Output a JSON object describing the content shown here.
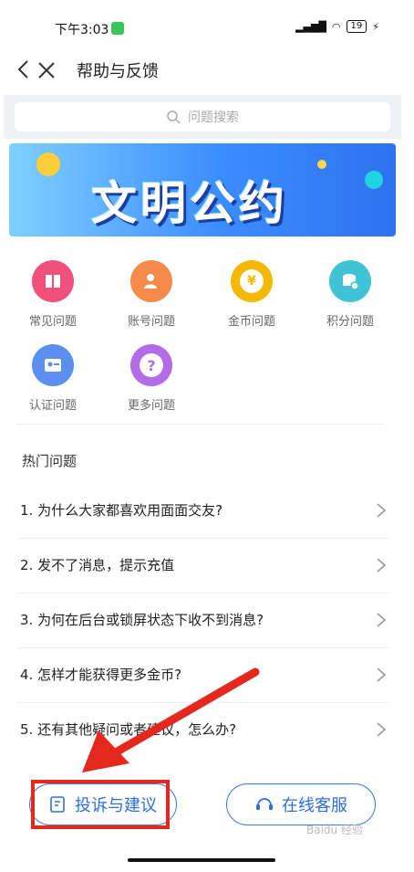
{
  "status": {
    "time": "下午3:03",
    "battery": "19"
  },
  "nav": {
    "title": "帮助与反馈"
  },
  "search": {
    "placeholder": "问题搜索"
  },
  "banner": {
    "title": "文明公约"
  },
  "categories": [
    {
      "label": "常见问题",
      "icon": "book-icon",
      "color": "#f0507a"
    },
    {
      "label": "账号问题",
      "icon": "account-icon",
      "color": "#f58a4a"
    },
    {
      "label": "金币问题",
      "icon": "coin-icon",
      "color": "#f5b800"
    },
    {
      "label": "积分问题",
      "icon": "points-icon",
      "color": "#3ec4d4"
    },
    {
      "label": "认证问题",
      "icon": "id-card-icon",
      "color": "#5b8ff0"
    },
    {
      "label": "更多问题",
      "icon": "question-icon",
      "color": "#b46be8"
    }
  ],
  "hot": {
    "title": "热门问题",
    "items": [
      "1. 为什么大家都喜欢用面面交友?",
      "2. 发不了消息，提示充值",
      "3. 为何在后台或锁屏状态下收不到消息?",
      "4. 怎样才能获得更多金币?",
      "5. 还有其他疑问或者建议，怎么办?"
    ]
  },
  "actions": {
    "feedback": "投诉与建议",
    "service": "在线客服"
  },
  "watermark": "Baidu 经验"
}
